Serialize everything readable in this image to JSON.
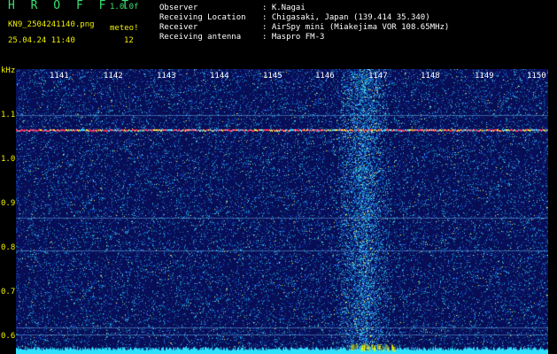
{
  "header": {
    "brand": "H R O F F T",
    "version": "1.0.0f",
    "filename": "KN9_2504241140.png",
    "datetime": "25.04.24 11:40",
    "meteor_label": "meteo!",
    "meteor_count": "12",
    "info": [
      {
        "key": "Observer",
        "value": ": K.Nagai"
      },
      {
        "key": "Receiving Location",
        "value": ": Chigasaki, Japan (139.414 35.340)"
      },
      {
        "key": "Receiver",
        "value": ": AirSpy mini (Miakejima VOR 108.65MHz)"
      },
      {
        "key": "Receiving antenna",
        "value": ": Maspro FM-3"
      }
    ]
  },
  "spectrogram": {
    "y_unit": "kHz",
    "y_ticks": [
      "1.1",
      "1.0",
      "0.9",
      "0.8",
      "0.7",
      "0.6"
    ],
    "x_ticks": [
      "1141",
      "1142",
      "1143",
      "1144",
      "1145",
      "1146",
      "1147",
      "1148",
      "1149",
      "1150"
    ],
    "colors": {
      "background": "#0a1050",
      "carrier": "#ff3060",
      "echo": "#40d0ff",
      "baseline": "#30e0ff"
    }
  }
}
